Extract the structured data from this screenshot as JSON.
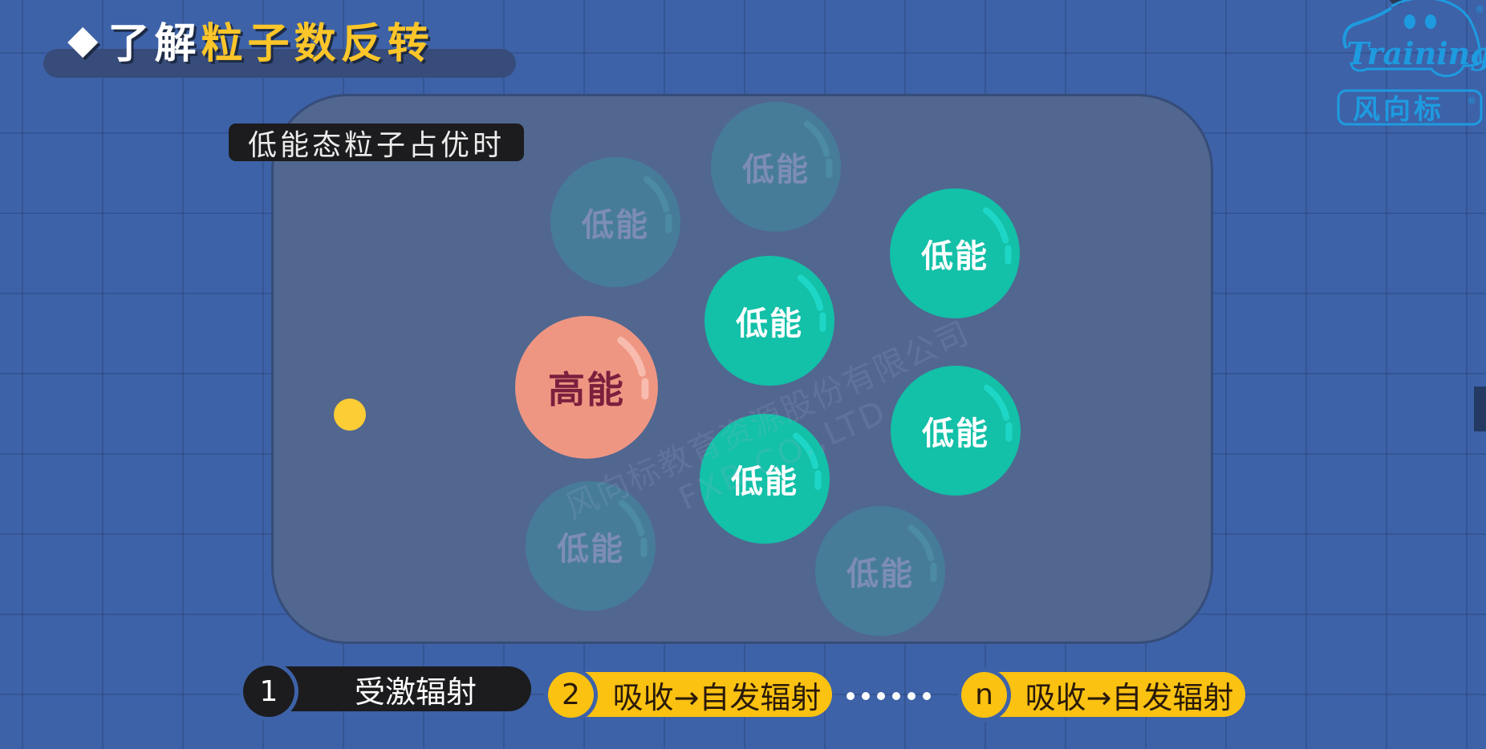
{
  "title": {
    "bullet": "◆",
    "prefix": "了解",
    "highlight": "粒子数反转"
  },
  "logo": {
    "script_text": "Training",
    "brand_text": "风向标",
    "registered": "®",
    "color": "#1e9be0"
  },
  "panel": {
    "state_label": "低能态粒子占优时",
    "particles": [
      {
        "label": "低能",
        "kind": "faded"
      },
      {
        "label": "低能",
        "kind": "faded"
      },
      {
        "label": "低能",
        "kind": "faded"
      },
      {
        "label": "低能",
        "kind": "faded"
      },
      {
        "label": "低能",
        "kind": "low"
      },
      {
        "label": "低能",
        "kind": "low"
      },
      {
        "label": "低能",
        "kind": "low"
      },
      {
        "label": "低能",
        "kind": "low"
      },
      {
        "label": "高能",
        "kind": "high"
      }
    ],
    "photon": "incident-photon"
  },
  "watermark": {
    "line1": "风向标教育资源股份有限公司",
    "line2": "FXB CO.,LTD"
  },
  "steps": [
    {
      "number": "1",
      "label": "受激辐射"
    },
    {
      "number": "2",
      "label": "吸收→自发辐射"
    },
    {
      "number": "n",
      "label": "吸收→自发辐射"
    }
  ],
  "colors": {
    "background": "#3d62a8",
    "low_energy": "#13c0a8",
    "high_energy": "#ef9683",
    "faded": "#477c98",
    "accent_yellow": "#fbc212",
    "dark": "#1c1c1e"
  }
}
